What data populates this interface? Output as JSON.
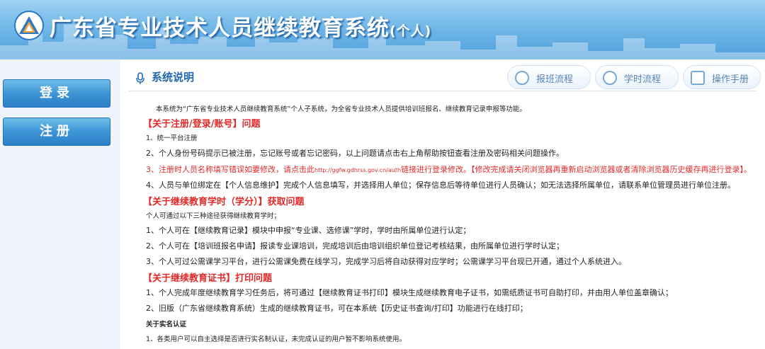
{
  "header": {
    "title": "广东省专业技术人员继续教育系统",
    "title_suffix": "(个人)"
  },
  "sidebar": {
    "items": [
      {
        "label": "登录"
      },
      {
        "label": "注册"
      }
    ]
  },
  "toolbar": {
    "buttons": [
      {
        "label": "报班流程"
      },
      {
        "label": "学时流程"
      },
      {
        "label": "操作手册"
      }
    ]
  },
  "section": {
    "title": "系统说明",
    "intro": "本系统为“广东省专业技术人员继续教育系统”个人子系统，为全省专业技术人员提供培训班报名、继续教育记录申报等功能。",
    "h1": "【关于注册/登录/账号】问题",
    "l1_1": "1、统一平台注册",
    "l1_2": "2、个人身份号码提示已被注册，忘记账号或者忘记密码，以上问题请点击右上角帮助按钮查看注册及密码相关问题操作。",
    "l1_3a": "3、注册时人员名称填写错误如要修改，请点击此",
    "l1_3url": "http://ggfw.gdhrss.gov.cn/auth",
    "l1_3b": "链接进行登录修改。【修改完成请关闭浏览器再重新启动浏览器或者清除浏览器历史缓存再进行登录】。",
    "l1_4": "4、人员与单位绑定在【个人信息维护】完成个人信息填写，并选择用人单位；保存信息后等待单位进行人员确认；如无法选择所属单位，请联系单位管理员进行单位注册。",
    "h2": "【关于继续教育学时（学分）】获取问题",
    "l2_0": "个人可通过以下三种途径获得继续教育学时；",
    "l2_1": "1、个人可在【继续教育记录】模块中申报“专业课、选修课”学时，学时由所属单位进行认定；",
    "l2_2": "2、个人可在【培训班报名申请】报读专业课培训，完成培训后由培训组织单位登记考核结果，由所属单位进行学时认定；",
    "l2_3": "3、个人可过公需课学习平台，进行公需课免费在线学习，完成学习后将自动获得对应学时；公需课学习平台现已开通，通过个人系统进入。",
    "h3": "【关于继续教育证书】打印问题",
    "l3_1": "1、个人完成年度继续教育学习任务后，将可通过【继续教育证书打印】模块生成继续教育电子证书，如需纸质证书可自助打印，并由用人单位盖章确认；",
    "l3_2": "2、旧版（广东省继续教育系统）生成的继续教育证书，可在本系统【历史证书查询/打印】功能进行在线打印；",
    "h4": "关于实名认证",
    "l4_1": "1、各类用户可以自主选择是否进行实名制认证，未完成认证的用户暂不影响系统使用。"
  },
  "colors": {
    "accent": "#2168b0",
    "warning": "#e02a2a",
    "header_blue": "#4f9fdc"
  },
  "icons": [
    "logo-icon",
    "microphone-icon",
    "flow-icon",
    "book-icon"
  ]
}
